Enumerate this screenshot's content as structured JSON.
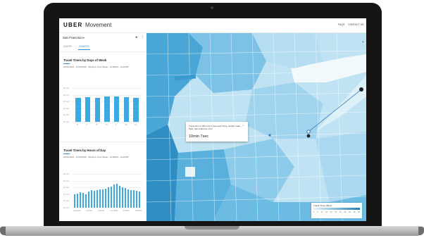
{
  "header": {
    "brand": "UBER",
    "product": "Movement",
    "nav": {
      "faq": "FAQS",
      "contact": "CONTACT US"
    }
  },
  "sidebar": {
    "city": "San Francisco",
    "tabs": [
      {
        "label": "QUERY"
      },
      {
        "label": "CHARTS"
      }
    ],
    "active_tab": "CHARTS"
  },
  "charts": [
    {
      "title": "Travel Times by Days of Week",
      "subtitle": "10/01/2016 - 12/31/2016 · All Days of the Week · 12:00AM - 12:00PM",
      "type": "bar",
      "y_ticks": [
        "20 min",
        "18 min",
        "16 min",
        "14 min",
        "12 min",
        "10 min"
      ],
      "categories": [
        "M",
        "T",
        "W",
        "Th",
        "F",
        "Sa",
        "Su"
      ],
      "values": [
        17.0,
        17.3,
        17.0,
        17.5,
        17.5,
        17.3,
        17.0
      ],
      "ylim": [
        10,
        20
      ]
    },
    {
      "title": "Travel Times by Hours of Day",
      "subtitle": "10/01/2016 - 12/31/2016 · All Days of the Week · 12:00AM - 12:00PM",
      "type": "bar",
      "y_ticks": [
        "20 min",
        "18 min",
        "16 min",
        "14 min",
        "12 min",
        "10 min"
      ],
      "x_ticks": [
        "12:00AM",
        "4:00AM",
        "8:00AM",
        "12:00PM",
        "4:00PM",
        "8:00PM"
      ],
      "values": [
        14.0,
        14.2,
        14.5,
        14.3,
        14.0,
        14.8,
        15.2,
        15.0,
        15.3,
        15.5,
        15.4,
        15.6,
        16.0,
        16.3,
        16.8,
        17.0,
        16.5,
        16.0,
        15.8,
        15.5,
        15.3,
        15.2,
        15.0,
        14.8
      ],
      "ylim": [
        10,
        20
      ]
    }
  ],
  "popup": {
    "text": "Travel time to 390 John F Kennedy Drive, Golden Gate Park, San Francisco from",
    "time": "10min 7sec"
  },
  "legend": {
    "title": "Travel Times (Mins)",
    "ticks": [
      "0",
      "5",
      "10",
      "15",
      "20",
      "25",
      "30",
      "35",
      "40",
      "45",
      "50"
    ]
  },
  "colors": {
    "accent": "#2e8ad3",
    "bar": "#3da9e1",
    "map_dark": "#2f8fc4",
    "map_light": "#d7eef8"
  }
}
